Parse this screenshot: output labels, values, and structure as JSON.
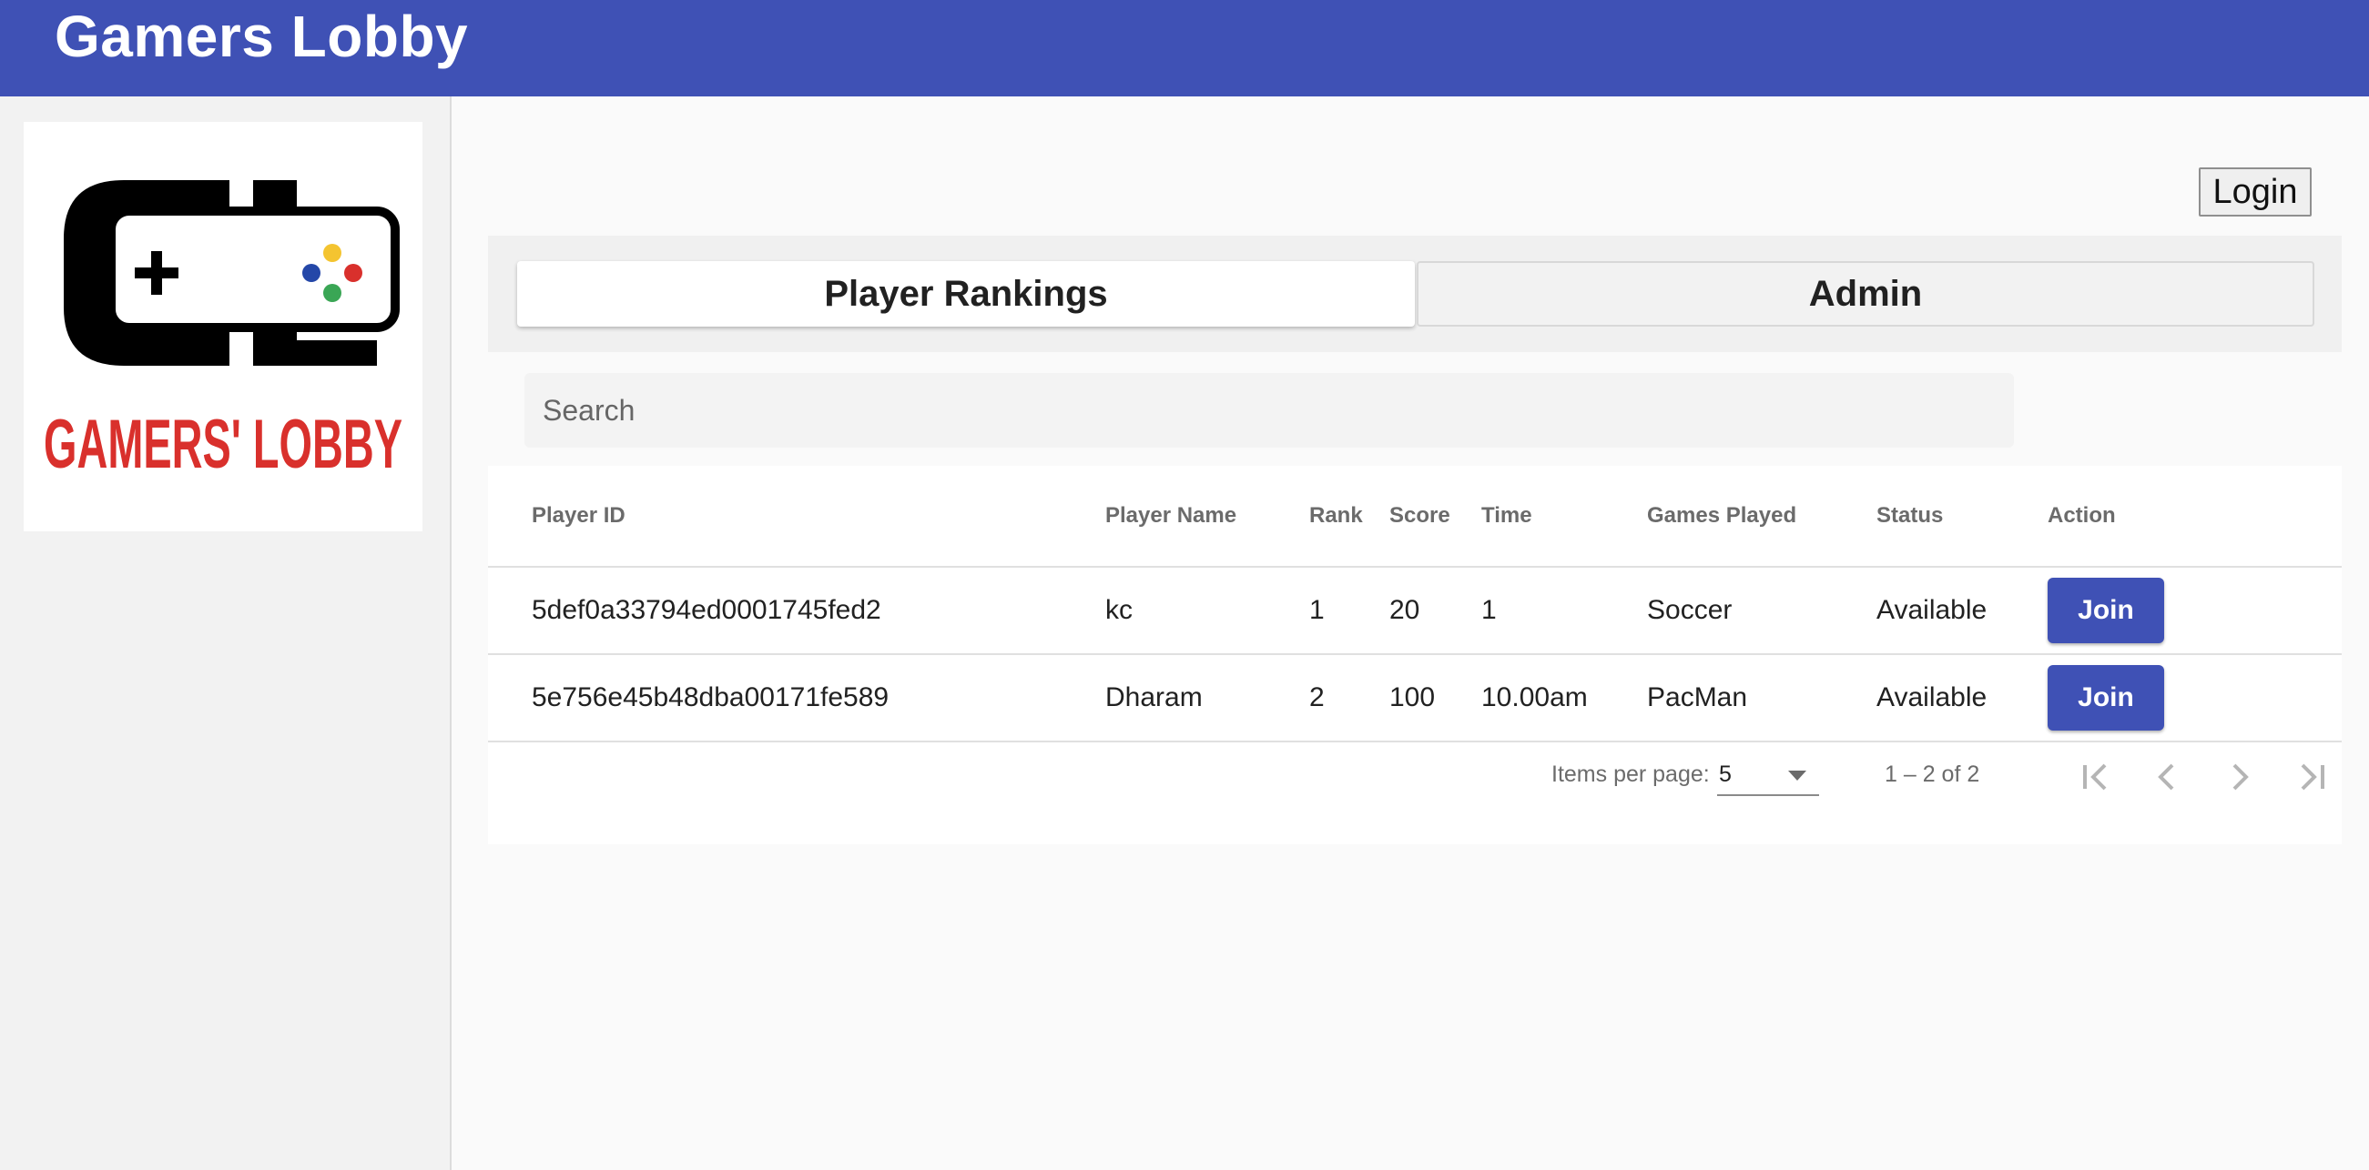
{
  "app": {
    "title": "Gamers Lobby"
  },
  "logo": {
    "text": "GAMERS' LOBBY"
  },
  "header": {
    "login_label": "Login"
  },
  "tabs": [
    {
      "label": "Player Rankings",
      "active": true
    },
    {
      "label": "Admin",
      "active": false
    }
  ],
  "search": {
    "placeholder": "Search",
    "value": ""
  },
  "table": {
    "columns": [
      "Player ID",
      "Player Name",
      "Rank",
      "Score",
      "Time",
      "Games Played",
      "Status",
      "Action"
    ],
    "rows": [
      {
        "player_id": "5def0a33794ed0001745fed2",
        "player_name": "kc",
        "rank": "1",
        "score": "20",
        "time": "1",
        "games_played": "Soccer",
        "status": "Available",
        "action": "Join"
      },
      {
        "player_id": "5e756e45b48dba00171fe589",
        "player_name": "Dharam",
        "rank": "2",
        "score": "100",
        "time": "10.00am",
        "games_played": "PacMan",
        "status": "Available",
        "action": "Join"
      }
    ]
  },
  "paginator": {
    "items_per_page_label": "Items per page:",
    "page_size": "5",
    "range_label": "1 – 2 of 2"
  },
  "colors": {
    "primary": "#3f51b5",
    "logo_red": "#d9302c",
    "dot_yellow": "#f4c430",
    "dot_blue": "#2447a8",
    "dot_green": "#3aa655",
    "dot_red": "#d9302c"
  },
  "icons": [
    "gamepad-logo-icon",
    "first-page-icon",
    "previous-page-icon",
    "next-page-icon",
    "last-page-icon",
    "dropdown-arrow-icon"
  ]
}
